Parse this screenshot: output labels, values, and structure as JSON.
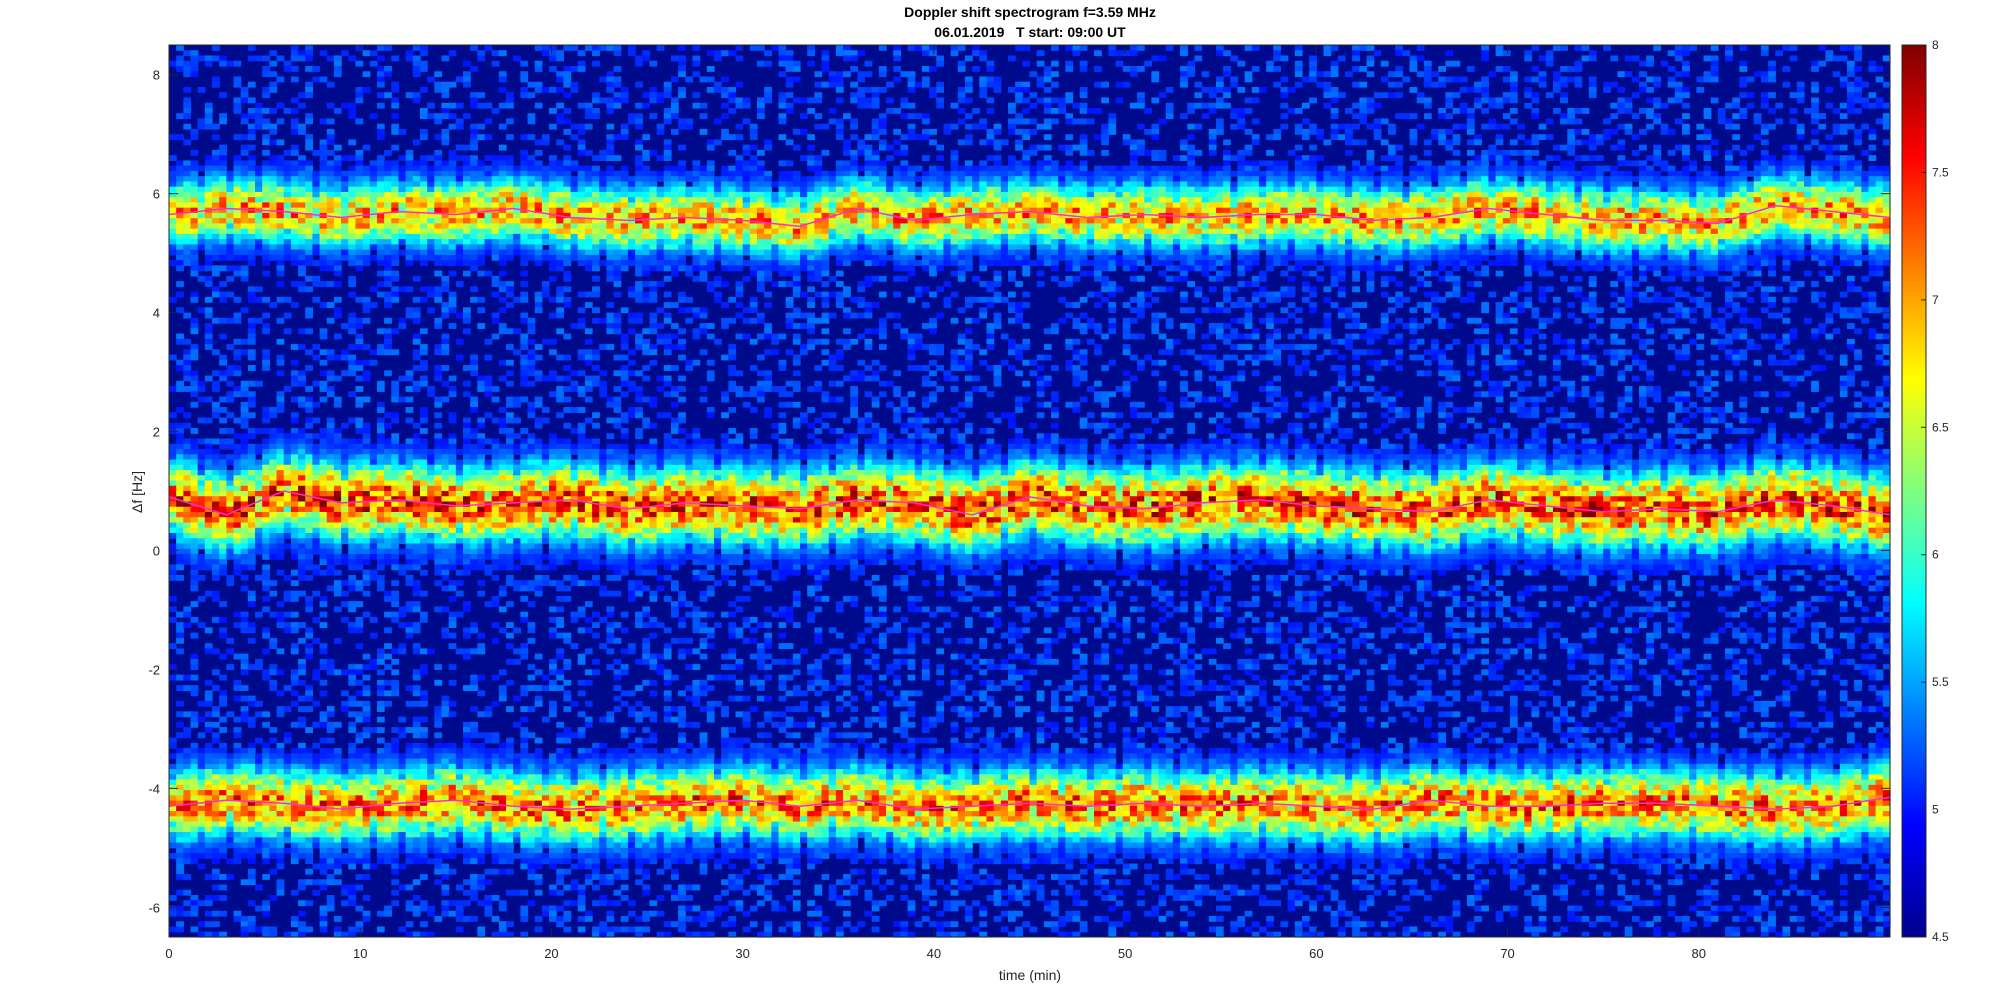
{
  "chart_data": {
    "type": "heatmap",
    "title": "Doppler shift spectrogram f=3.59 MHz",
    "subtitle": "06.01.2019   T start: 09:00 UT",
    "xlabel": "time (min)",
    "ylabel": "Δf [Hz]",
    "xlim": [
      0,
      90
    ],
    "ylim": [
      -6.5,
      8.5
    ],
    "x_ticks": [
      "0",
      "10",
      "20",
      "30",
      "40",
      "50",
      "60",
      "70",
      "80"
    ],
    "x_tick_values": [
      0,
      10,
      20,
      30,
      40,
      50,
      60,
      70,
      80
    ],
    "y_ticks": [
      "8",
      "6",
      "4",
      "2",
      "0",
      "-2",
      "-4",
      "-6"
    ],
    "y_tick_values": [
      8,
      6,
      4,
      2,
      0,
      -2,
      -4,
      -6
    ],
    "colormap": "jet",
    "colorbar": {
      "range": [
        4.5,
        8
      ],
      "ticks": [
        "8",
        "7.5",
        "7",
        "6.5",
        "6",
        "5.5",
        "5",
        "4.5"
      ],
      "tick_values": [
        8,
        7.5,
        7,
        6.5,
        6,
        5.5,
        5,
        4.5
      ]
    },
    "background_level": 4.9,
    "grid": false,
    "colors": {
      "trace": "#ff2bd0",
      "background": "#000a8c"
    },
    "series": [
      {
        "x": [
          0,
          3,
          6,
          9,
          12,
          15,
          18,
          21,
          24,
          27,
          30,
          33,
          36,
          39,
          42,
          45,
          48,
          51,
          54,
          57,
          60,
          63,
          66,
          69,
          72,
          75,
          78,
          81,
          84,
          87,
          90
        ],
        "values": [
          5.65,
          5.75,
          5.7,
          5.6,
          5.7,
          5.65,
          5.75,
          5.6,
          5.55,
          5.6,
          5.55,
          5.45,
          5.75,
          5.55,
          5.65,
          5.7,
          5.6,
          5.65,
          5.6,
          5.65,
          5.65,
          5.55,
          5.6,
          5.75,
          5.65,
          5.55,
          5.55,
          5.5,
          5.8,
          5.7,
          5.6
        ],
        "width": 0.5,
        "peak": 7.2
      },
      {
        "x": [
          0,
          3,
          6,
          9,
          12,
          15,
          18,
          21,
          24,
          27,
          30,
          33,
          36,
          39,
          42,
          45,
          48,
          51,
          54,
          57,
          60,
          63,
          66,
          69,
          72,
          75,
          78,
          81,
          84,
          87,
          90
        ],
        "values": [
          0.9,
          0.6,
          1.0,
          0.8,
          0.85,
          0.75,
          0.8,
          0.85,
          0.7,
          0.8,
          0.75,
          0.7,
          0.85,
          0.8,
          0.6,
          0.9,
          0.75,
          0.7,
          0.8,
          0.85,
          0.75,
          0.7,
          0.65,
          0.85,
          0.75,
          0.65,
          0.7,
          0.65,
          0.85,
          0.75,
          0.6
        ],
        "width": 0.6,
        "peak": 7.6
      },
      {
        "x": [
          0,
          3,
          6,
          9,
          12,
          15,
          18,
          21,
          24,
          27,
          30,
          33,
          36,
          39,
          42,
          45,
          48,
          51,
          54,
          57,
          60,
          63,
          66,
          69,
          72,
          75,
          78,
          81,
          84,
          87,
          90
        ],
        "values": [
          -4.3,
          -4.2,
          -4.25,
          -4.35,
          -4.25,
          -4.2,
          -4.3,
          -4.35,
          -4.3,
          -4.25,
          -4.2,
          -4.3,
          -4.2,
          -4.35,
          -4.3,
          -4.25,
          -4.3,
          -4.25,
          -4.3,
          -4.25,
          -4.3,
          -4.35,
          -4.2,
          -4.3,
          -4.3,
          -4.25,
          -4.25,
          -4.3,
          -4.35,
          -4.3,
          -4.15
        ],
        "width": 0.55,
        "peak": 7.4
      }
    ]
  }
}
